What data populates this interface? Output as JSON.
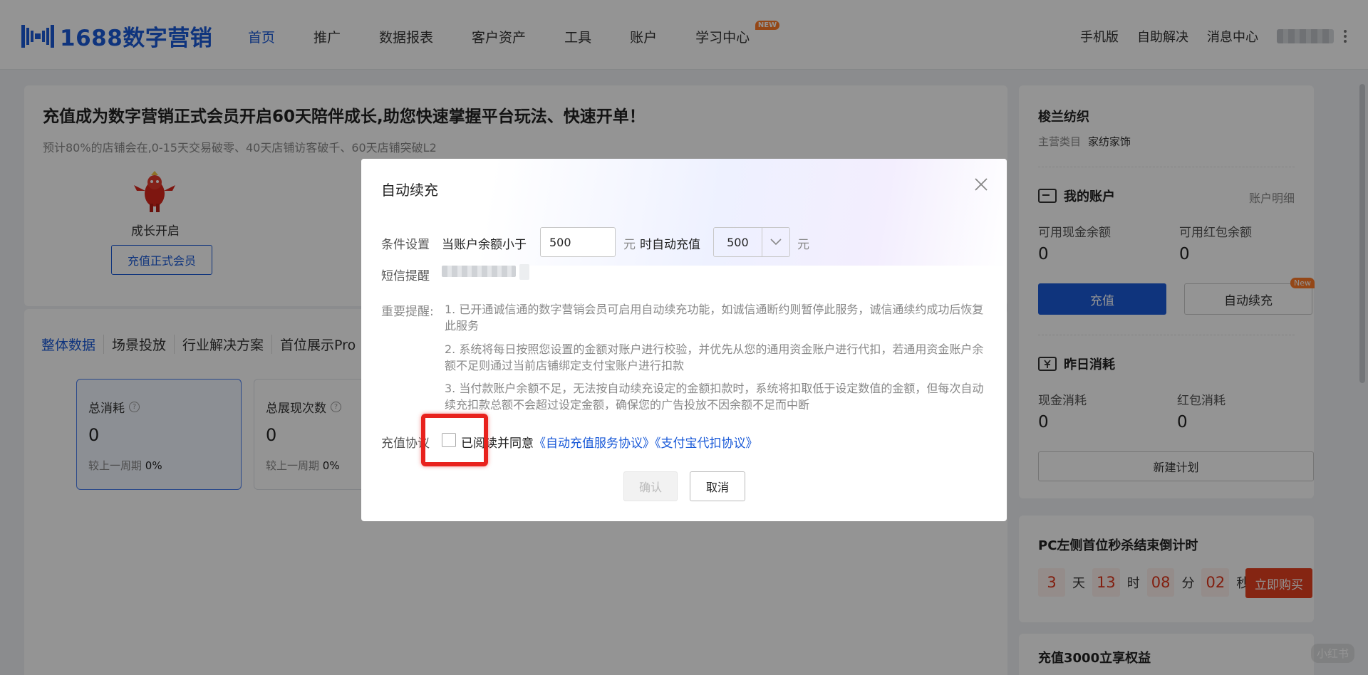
{
  "nav": {
    "logo_text": "1688数字营销",
    "items": [
      {
        "label": "首页",
        "active": true
      },
      {
        "label": "推广"
      },
      {
        "label": "数据报表"
      },
      {
        "label": "客户资产"
      },
      {
        "label": "工具"
      },
      {
        "label": "账户"
      },
      {
        "label": "学习中心",
        "badge": "NEW"
      }
    ],
    "right_links": [
      "手机版",
      "自助解决",
      "消息中心"
    ]
  },
  "banner": {
    "headline": "充值成为数字营销正式会员开启60天陪伴成长,助您快速掌握平台玩法、快速开单！",
    "subline": "预计80%的店铺会在,0-15天交易破零、40天店铺访客破千、60天店铺突破L2",
    "growth_label": "成长开启",
    "recharge_member_btn": "充值正式会员"
  },
  "data_panel": {
    "tabs": [
      "整体数据",
      "场景投放",
      "行业解决方案",
      "首位展示Pro"
    ],
    "metrics": [
      {
        "title": "总消耗",
        "value": "0",
        "compare_label": "较上一周期",
        "compare_value": "0%"
      },
      {
        "title": "总展现次数",
        "value": "0",
        "compare_label": "较上一周期",
        "compare_value": "0%"
      }
    ]
  },
  "side": {
    "shop_name": "梭兰纺织",
    "category_label": "主营类目",
    "category_value": "家纺家饰",
    "my_account_title": "我的账户",
    "account_detail_link": "账户明细",
    "cash_balance_label": "可用现金余额",
    "cash_balance_value": "0",
    "redpacket_balance_label": "可用红包余额",
    "redpacket_balance_value": "0",
    "recharge_btn": "充值",
    "auto_recharge_btn": "自动续充",
    "auto_recharge_badge": "New",
    "yesterday_title": "昨日消耗",
    "cash_cost_label": "现金消耗",
    "cash_cost_value": "0",
    "redpacket_cost_label": "红包消耗",
    "redpacket_cost_value": "0",
    "new_plan_btn": "新建计划"
  },
  "promo": {
    "title": "PC左侧首位秒杀结束倒计时",
    "days": "3",
    "days_unit": "天",
    "hours": "13",
    "hours_unit": "时",
    "minutes": "08",
    "minutes_unit": "分",
    "seconds": "02",
    "seconds_unit": "秒",
    "buy_btn": "立即购买",
    "title2": "充值3000立享权益"
  },
  "watermark": "小红书",
  "modal": {
    "title": "自动续充",
    "condition_label": "条件设置",
    "condition_prefix": "当账户余额小于",
    "threshold_value": "500",
    "unit": "元",
    "condition_mid": "时自动充值",
    "recharge_amount": "500",
    "sms_label": "短信提醒",
    "notice_label": "重要提醒:",
    "notices": [
      "1. 已开通诚信通的数字营销会员可启用自动续充功能，如诚信通断约则暂停此服务，诚信通续约成功后恢复此服务",
      "2. 系统将每日按照您设置的金额对账户进行校验，并优先从您的通用资金账户进行代扣，若通用资金账户余额不足则通过当前店铺绑定支付宝账户进行扣款",
      "3. 当付款账户余额不足，无法按自动续充设定的金额扣款时，系统将扣取低于设定数值的金额，但每次自动续充扣款总额不会超过设定金额，确保您的广告投放不因余额不足而中断"
    ],
    "agreement_label": "充值协议",
    "agreement_prefix": "已阅读并同意",
    "agreement_link_1": "《自动充值服务协议》",
    "agreement_link_2": "《支付宝代扣协议》",
    "confirm_btn": "确认",
    "cancel_btn": "取消"
  },
  "colors": {
    "brand_blue": "#1a5ad8",
    "highlight_red": "#e8221d",
    "countdown_red": "#e0351a",
    "badge_orange": "#ff7a29"
  }
}
